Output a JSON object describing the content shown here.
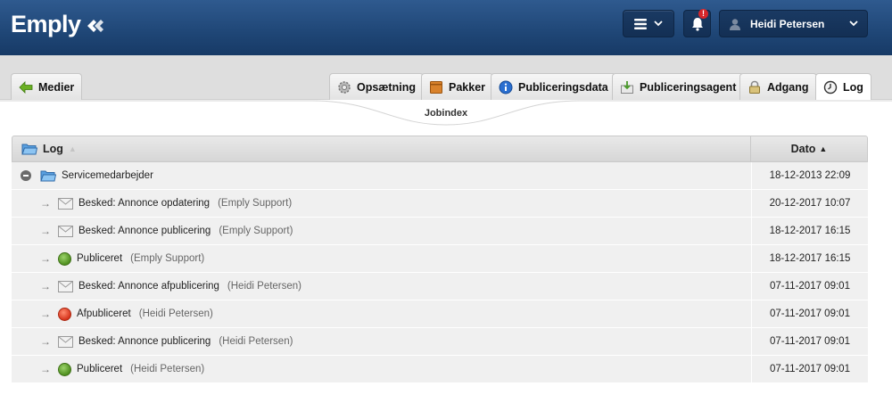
{
  "header": {
    "logo_text": "Emply",
    "bell_badge": "!",
    "user_name": "Heidi Petersen"
  },
  "tabs": {
    "back_label": "Medier",
    "items": [
      {
        "label": "Opsætning",
        "icon": "gear-icon"
      },
      {
        "label": "Pakker",
        "icon": "package-icon"
      },
      {
        "label": "Publiceringsdata",
        "icon": "info-icon"
      },
      {
        "label": "Publiceringsagent",
        "icon": "agent-icon"
      },
      {
        "label": "Adgang",
        "icon": "lock-icon"
      },
      {
        "label": "Log",
        "icon": "clock-icon",
        "active": true
      }
    ]
  },
  "sublabel": "Jobindex",
  "table": {
    "col_log": "Log",
    "col_date": "Dato",
    "sort_indicator": "▲",
    "folder": {
      "label": "Servicemedarbejder",
      "date": "18-12-2013 22:09"
    },
    "rows": [
      {
        "icon": "mail-icon",
        "text": "Besked: Annonce opdatering",
        "author": "(Emply Support)",
        "date": "20-12-2017 10:07"
      },
      {
        "icon": "mail-icon",
        "text": "Besked: Annonce publicering",
        "author": "(Emply Support)",
        "date": "18-12-2017 16:15"
      },
      {
        "icon": "status-green-icon",
        "text": "Publiceret",
        "author": "(Emply Support)",
        "date": "18-12-2017 16:15"
      },
      {
        "icon": "mail-icon",
        "text": "Besked: Annonce afpublicering",
        "author": "(Heidi Petersen)",
        "date": "07-11-2017 09:01"
      },
      {
        "icon": "status-red-icon",
        "text": "Afpubliceret",
        "author": "(Heidi Petersen)",
        "date": "07-11-2017 09:01"
      },
      {
        "icon": "mail-icon",
        "text": "Besked: Annonce publicering",
        "author": "(Heidi Petersen)",
        "date": "07-11-2017 09:01"
      },
      {
        "icon": "status-green-icon",
        "text": "Publiceret",
        "author": "(Heidi Petersen)",
        "date": "07-11-2017 09:01"
      }
    ]
  },
  "colors": {
    "header_blue": "#1f4676",
    "tab_bg": "#dedede",
    "row_bg": "#f0f0f0",
    "status_green": "#5a9a26",
    "status_red": "#d6341c"
  }
}
